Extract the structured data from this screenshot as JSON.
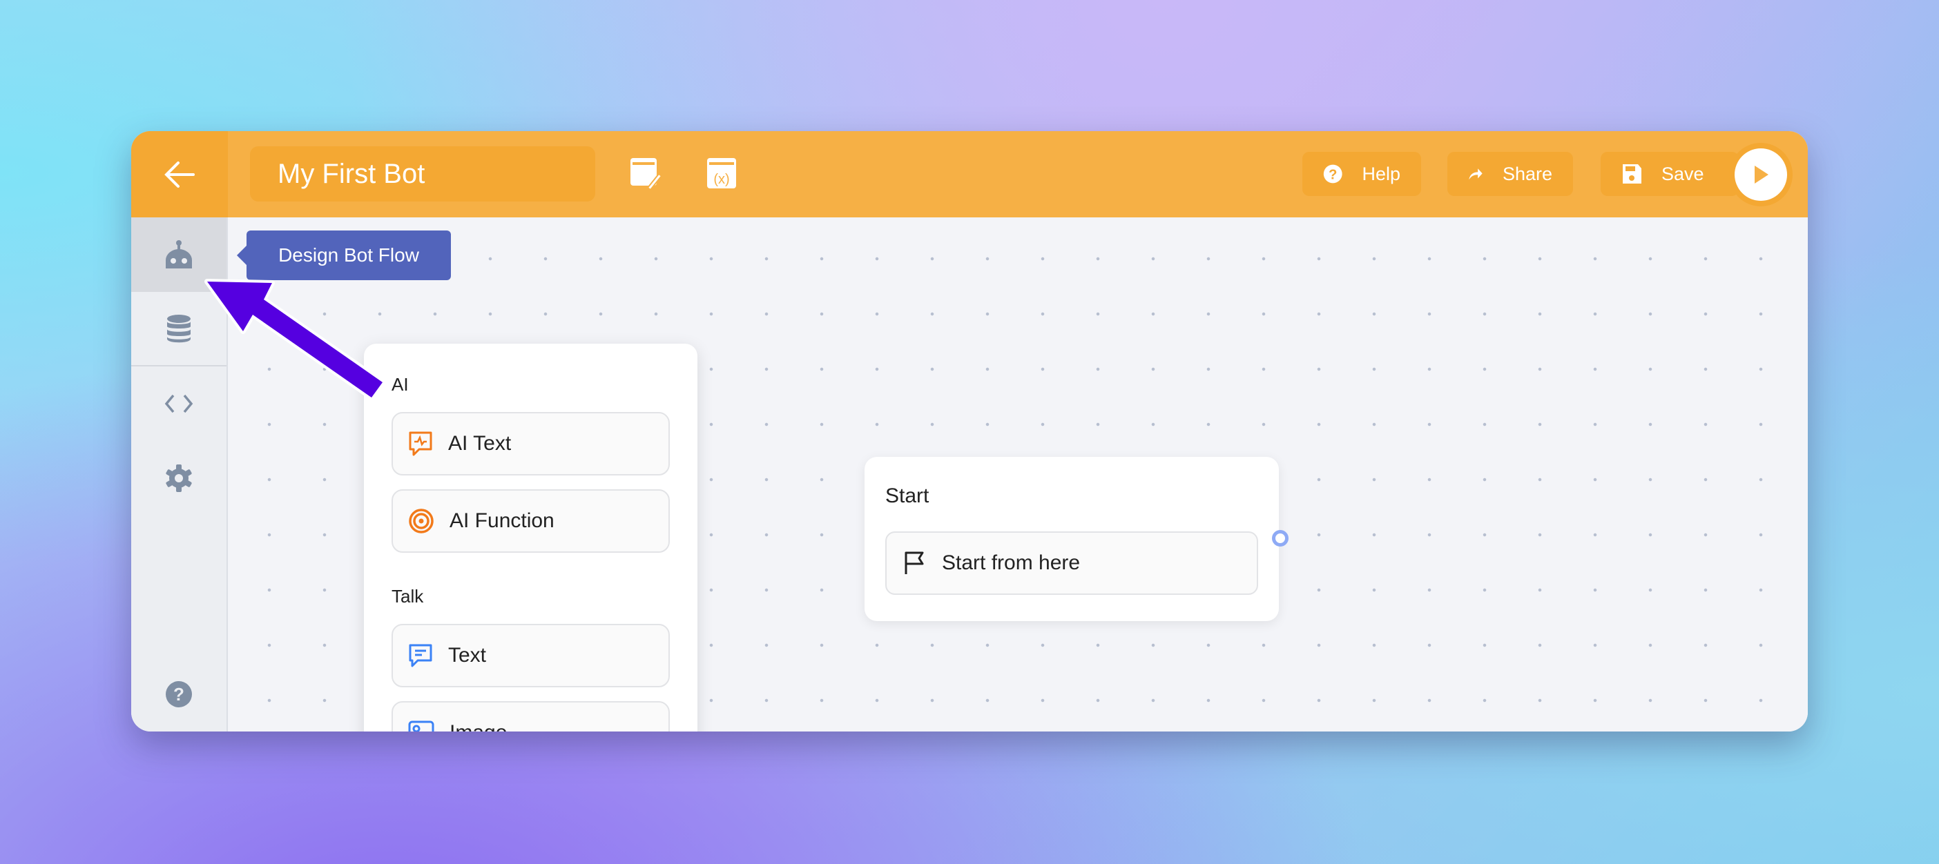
{
  "header": {
    "title": "My First Bot",
    "help_label": "Help",
    "share_label": "Share",
    "save_label": "Save"
  },
  "tooltip": "Design Bot Flow",
  "panel": {
    "sections": [
      {
        "label": "AI",
        "items": [
          {
            "label": "AI Text",
            "icon": "ai-text-icon"
          },
          {
            "label": "AI Function",
            "icon": "target-icon"
          }
        ]
      },
      {
        "label": "Talk",
        "items": [
          {
            "label": "Text",
            "icon": "chat-icon"
          },
          {
            "label": "Image",
            "icon": "image-icon"
          }
        ]
      }
    ]
  },
  "start_node": {
    "title": "Start",
    "block_label": "Start from here"
  },
  "colors": {
    "header": "#f6b045",
    "accent": "#f4a833",
    "tooltip": "#5264bb",
    "arrow": "#5500e0",
    "ai_icon": "#f27a1a",
    "talk_icon": "#3b82f6"
  }
}
